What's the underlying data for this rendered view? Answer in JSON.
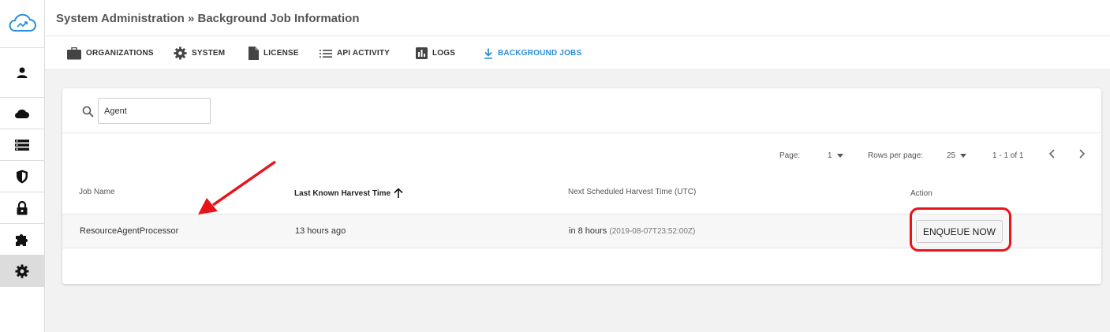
{
  "header": {
    "breadcrumb": "System Administration » Background Job Information"
  },
  "sidebar": {
    "items": [
      {
        "name": "user-icon"
      },
      {
        "name": "cloud-icon"
      },
      {
        "name": "server-icon"
      },
      {
        "name": "shield-icon"
      },
      {
        "name": "lock-icon"
      },
      {
        "name": "puzzle-icon"
      },
      {
        "name": "gear-icon",
        "active": true
      }
    ]
  },
  "tabs": [
    {
      "label": "ORGANIZATIONS",
      "icon": "briefcase-icon"
    },
    {
      "label": "SYSTEM",
      "icon": "gear-icon"
    },
    {
      "label": "LICENSE",
      "icon": "document-icon"
    },
    {
      "label": "API ACTIVITY",
      "icon": "list-icon"
    },
    {
      "label": "LOGS",
      "icon": "bar-chart-icon"
    },
    {
      "label": "BACKGROUND JOBS",
      "icon": "download-icon",
      "active": true
    }
  ],
  "search": {
    "value": "Agent"
  },
  "pagination": {
    "page_label": "Page:",
    "page_value": "1",
    "rows_label": "Rows per page:",
    "rows_value": "25",
    "range": "1 - 1 of 1"
  },
  "table": {
    "columns": {
      "job_name": "Job Name",
      "last_harvest": "Last Known Harvest Time",
      "next_harvest": "Next Scheduled Harvest Time (UTC)",
      "action": "Action"
    },
    "rows": [
      {
        "job_name": "ResourceAgentProcessor",
        "last_harvest": "13 hours ago",
        "next_harvest": "in 8 hours",
        "next_harvest_exact": "(2019-08-07T23:52:00Z)",
        "action_label": "ENQUEUE NOW"
      }
    ]
  },
  "colors": {
    "accent": "#2a8fd6",
    "annotation": "#e8141a"
  }
}
